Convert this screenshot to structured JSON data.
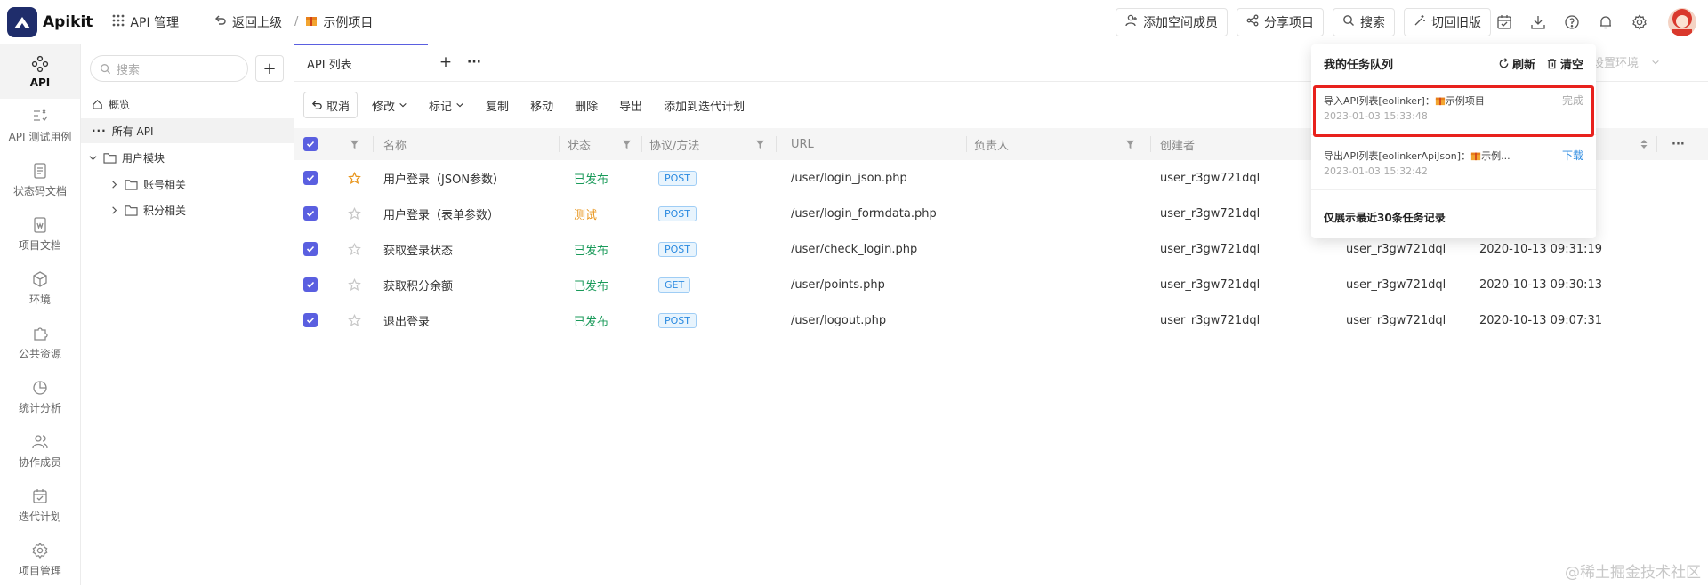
{
  "topbar": {
    "brand": "Apikit",
    "api_manage": "API 管理",
    "back": "返回上级",
    "separator": "/",
    "project": "示例项目",
    "add_member": "添加空间成员",
    "share": "分享项目",
    "search": "搜索",
    "old_version": "切回旧版"
  },
  "sidebar": {
    "items": [
      {
        "label": "API",
        "icon": "api-icon"
      },
      {
        "label": "API 测试用例",
        "icon": "test-case-icon"
      },
      {
        "label": "状态码文档",
        "icon": "status-doc-icon"
      },
      {
        "label": "项目文档",
        "icon": "project-doc-icon"
      },
      {
        "label": "环境",
        "icon": "environment-icon"
      },
      {
        "label": "公共资源",
        "icon": "puzzle-icon"
      },
      {
        "label": "统计分析",
        "icon": "pie-chart-icon"
      },
      {
        "label": "协作成员",
        "icon": "members-icon"
      },
      {
        "label": "迭代计划",
        "icon": "calendar-icon"
      },
      {
        "label": "项目管理",
        "icon": "gear-icon"
      }
    ]
  },
  "tree": {
    "search_placeholder": "搜索",
    "add": "+",
    "overview": "概览",
    "all_api": "所有 API",
    "user_module": "用户模块",
    "account": "账号相关",
    "points": "积分相关"
  },
  "tabs": {
    "api_list": "API 列表",
    "add": "+",
    "more": "···"
  },
  "toolbar": {
    "cancel": "取消",
    "modify": "修改",
    "mark": "标记",
    "copy": "复制",
    "move": "移动",
    "delete": "删除",
    "export": "导出",
    "add_iteration": "添加到迭代计划"
  },
  "table": {
    "headers": {
      "name": "名称",
      "status": "状态",
      "protocol": "协议/方法",
      "url": "URL",
      "owner": "负责人",
      "creator": "创建者"
    },
    "rows": [
      {
        "name": "用户登录（JSON参数）",
        "status": "已发布",
        "status_color": "#1a9a5a",
        "method": "POST",
        "url": "/user/login_json.php",
        "creator": "user_r3gw721dql",
        "modifier": "",
        "time": "",
        "starred": true
      },
      {
        "name": "用户登录（表单参数）",
        "status": "测试",
        "status_color": "#e8951c",
        "method": "POST",
        "url": "/user/login_formdata.php",
        "creator": "user_r3gw721dql",
        "modifier": "",
        "time": "",
        "starred": false
      },
      {
        "name": "获取登录状态",
        "status": "已发布",
        "status_color": "#1a9a5a",
        "method": "POST",
        "url": "/user/check_login.php",
        "creator": "user_r3gw721dql",
        "modifier": "user_r3gw721dql",
        "time": "2020-10-13 09:31:19",
        "starred": false
      },
      {
        "name": "获取积分余额",
        "status": "已发布",
        "status_color": "#1a9a5a",
        "method": "GET",
        "url": "/user/points.php",
        "creator": "user_r3gw721dql",
        "modifier": "user_r3gw721dql",
        "time": "2020-10-13 09:30:13",
        "starred": false
      },
      {
        "name": "退出登录",
        "status": "已发布",
        "status_color": "#1a9a5a",
        "method": "POST",
        "url": "/user/logout.php",
        "creator": "user_r3gw721dql",
        "modifier": "user_r3gw721dql",
        "time": "2020-10-13 09:07:31",
        "starred": false
      }
    ]
  },
  "env_hint": "设置环境",
  "popup": {
    "title": "我的任务队列",
    "refresh": "刷新",
    "clear": "清空",
    "tasks": [
      {
        "text": "导入API列表[eolinker]：",
        "project": "示例项目",
        "time": "2023-01-03 15:33:48",
        "action": "完成"
      },
      {
        "text": "导出API列表[eolinkerApiJson]：",
        "project": "示例...",
        "time": "2023-01-03 15:32:42",
        "action": "下载"
      }
    ],
    "footer": "仅展示最近30条任务记录"
  },
  "watermark": "@稀土掘金技术社区",
  "colors": {
    "accent": "#5a5fe0",
    "published": "#1a9a5a",
    "testing": "#e8951c",
    "download": "#2b8ae0",
    "highlight": "#e8211c"
  }
}
